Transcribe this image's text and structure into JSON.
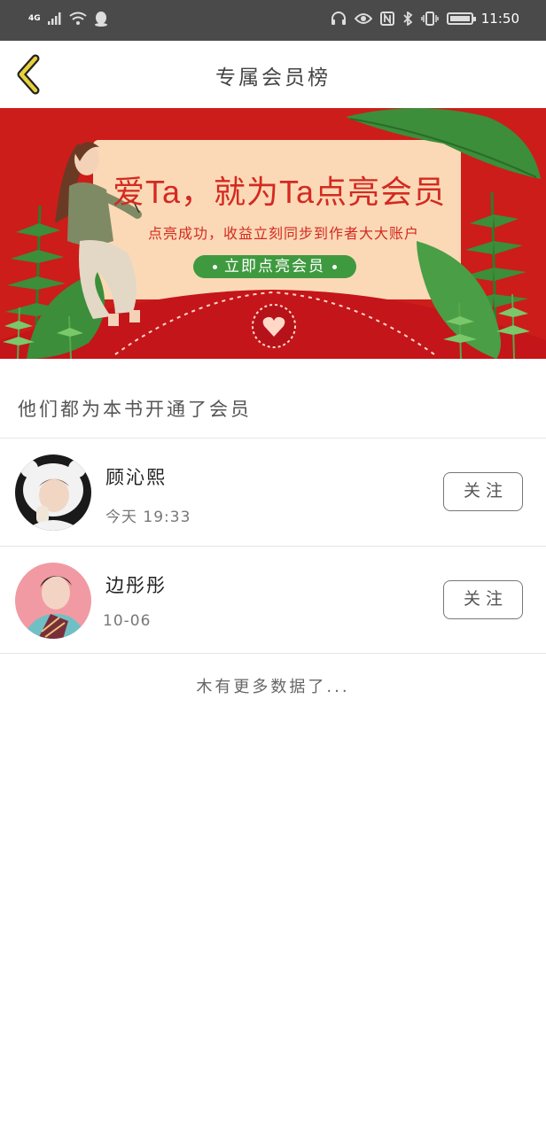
{
  "status_bar": {
    "network": "4G",
    "time": "11:50"
  },
  "nav": {
    "title": "专属会员榜"
  },
  "banner": {
    "headline": "爱Ta，就为Ta点亮会员",
    "subtitle": "点亮成功，收益立刻同步到作者大大账户",
    "cta_label": "立即点亮会员"
  },
  "section": {
    "title": "他们都为本书开通了会员"
  },
  "members": [
    {
      "name": "顾沁熙",
      "time": "今天 19:33",
      "follow_label": "关注"
    },
    {
      "name": "边彤彤",
      "time": "10-06",
      "follow_label": "关注"
    }
  ],
  "footer": {
    "no_more_text": "木有更多数据了..."
  },
  "colors": {
    "banner_red": "#cc1d1a",
    "banner_cream": "#fbd9b6",
    "cta_green": "#3f9a3f",
    "back_arrow": "#e8d23a"
  }
}
